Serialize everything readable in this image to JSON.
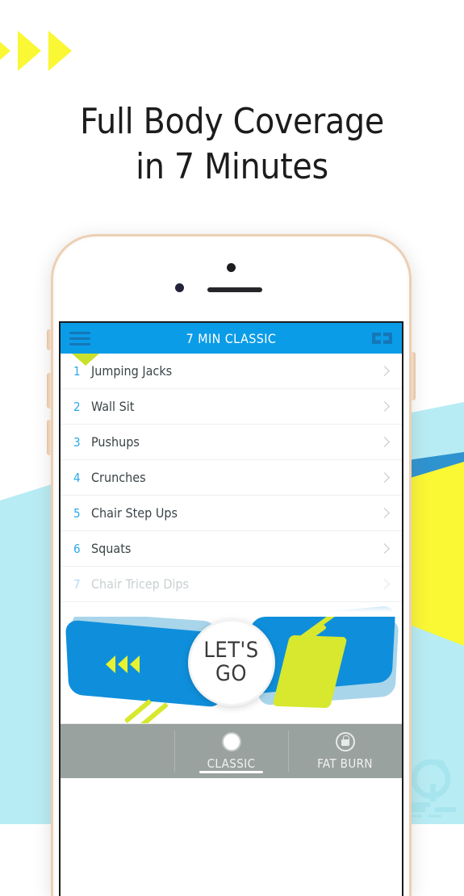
{
  "promo": {
    "headline_line1": "Full Body Coverage",
    "headline_line2": "in 7 Minutes",
    "chevron_icon": "chevron-right-icon",
    "chevron_count": 3,
    "chevron_color": "#faf734"
  },
  "colors": {
    "appbar_blue": "#0b9ce8",
    "accent_blue": "#2aa8e8",
    "banner_blue": "#0f8fdb",
    "lime": "#d7e82e",
    "yellow": "#faf734",
    "cyan": "#b8ecf4",
    "tabbar_gray": "#9aa2a0",
    "phone_bezel": "#eccfb4"
  },
  "phone": {
    "camera_icon": "camera-icon",
    "sensor_icon": "proximity-sensor-icon",
    "speaker_icon": "earpiece-speaker-icon",
    "silent_switch": "silent-switch",
    "volume_up": "volume-up-button",
    "volume_down": "volume-down-button",
    "power_button": "power-button"
  },
  "app": {
    "appbar": {
      "menu_icon": "hamburger-menu-icon",
      "title": "7 MIN CLASSIC",
      "right_icon": "cast-connect-icon"
    },
    "exercises": [
      {
        "num": "1",
        "label": "Jumping Jacks",
        "faded": false
      },
      {
        "num": "2",
        "label": "Wall Sit",
        "faded": false
      },
      {
        "num": "3",
        "label": "Pushups",
        "faded": false
      },
      {
        "num": "4",
        "label": "Crunches",
        "faded": false
      },
      {
        "num": "5",
        "label": "Chair Step Ups",
        "faded": false
      },
      {
        "num": "6",
        "label": "Squats",
        "faded": false
      },
      {
        "num": "7",
        "label": "Chair Tricep Dips",
        "faded": true
      }
    ],
    "cta": {
      "line1": "LET'S",
      "line2": "GO",
      "arrows_icon": "triple-arrow-left-icon"
    },
    "tabs": [
      {
        "label": "",
        "icon": "",
        "active": false,
        "locked": false
      },
      {
        "label": "CLASSIC",
        "icon": "circle-icon",
        "active": true,
        "locked": false
      },
      {
        "label": "FAT BURN",
        "icon": "lock-icon",
        "active": false,
        "locked": true
      }
    ]
  },
  "watermark": {
    "name": "site-watermark-logo"
  }
}
